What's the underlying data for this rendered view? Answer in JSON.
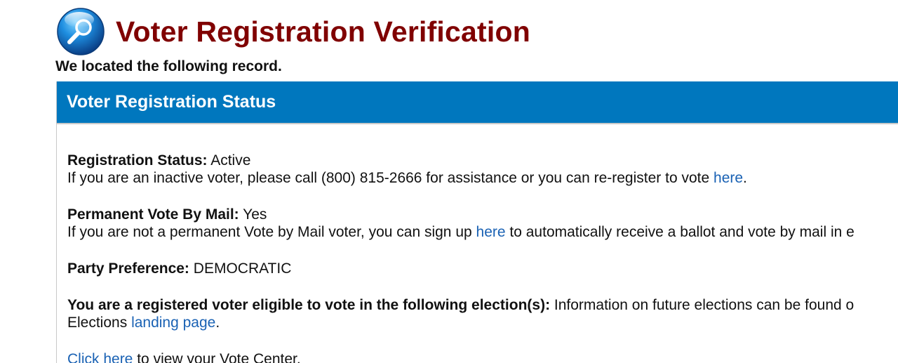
{
  "header": {
    "title": "Voter Registration Verification",
    "icon": "magnifier-globe-icon"
  },
  "intro": "We located the following record.",
  "panel": {
    "title": "Voter Registration Status",
    "registration": {
      "label": "Registration Status:",
      "value": "Active",
      "help_text": "If you are an inactive voter, please call (800) 815-2666 for assistance or you can re-register to vote",
      "link": "here",
      "suffix": "."
    },
    "vote_by_mail": {
      "label": "Permanent Vote By Mail:",
      "value": "Yes",
      "help_text": "If you are not a permanent Vote by Mail voter, you can sign up",
      "link": "here",
      "suffix": "to automatically receive a ballot and vote by mail in e"
    },
    "party": {
      "label": "Party Preference:",
      "value": "DEMOCRATIC"
    },
    "eligibility": {
      "label": "You are a registered voter eligible to vote in the following election(s):",
      "text": "Information on future elections can be found o",
      "line2_prefix": "Elections",
      "link": "landing page",
      "suffix": "."
    },
    "vote_center": {
      "link": "Click here",
      "text": "to view your Vote Center."
    }
  },
  "colors": {
    "title": "#800000",
    "panel_header": "#0077be",
    "link": "#1a62b4"
  }
}
